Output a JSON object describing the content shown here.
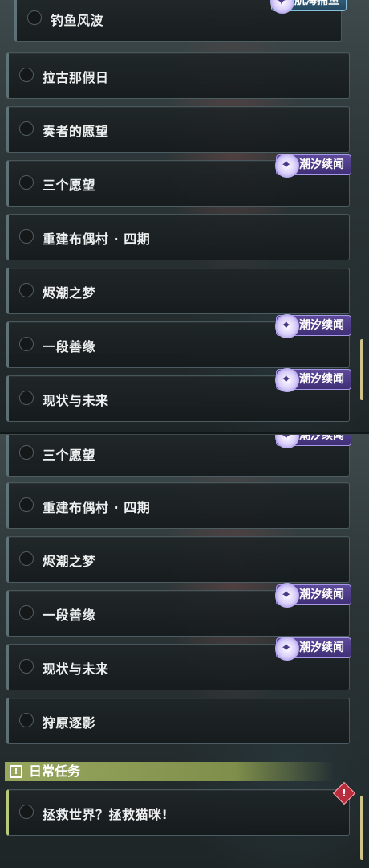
{
  "top_panel": {
    "items": [
      {
        "label": "钓鱼风波"
      },
      {
        "label": "拉古那假日"
      },
      {
        "label": "奏者的愿望"
      },
      {
        "label": "三个愿望"
      },
      {
        "label": "重建布偶村 · 四期"
      },
      {
        "label": "烬潮之梦"
      },
      {
        "label": "一段善缘"
      },
      {
        "label": "现状与未来"
      }
    ],
    "badges": {
      "voyage": "航海捕鱼",
      "tide_1": "潮汐续闻",
      "tide_2": "潮汐续闻",
      "tide_3": "潮汐续闻"
    }
  },
  "bottom_panel": {
    "items": [
      {
        "label": "三个愿望"
      },
      {
        "label": "重建布偶村 · 四期"
      },
      {
        "label": "烬潮之梦"
      },
      {
        "label": "一段善缘"
      },
      {
        "label": "现状与未来"
      },
      {
        "label": "狩原逐影"
      }
    ],
    "badges": {
      "tide_0": "潮汐续闻",
      "tide_1": "潮汐续闻",
      "tide_2": "潮汐续闻"
    },
    "section": {
      "title": "日常任务",
      "icon": "exclamation-icon"
    },
    "daily_item": {
      "label": "拯救世界？拯救猫咪!"
    }
  },
  "colors": {
    "badge_tide": "#4a3a86",
    "badge_voyage": "#2f5a78",
    "section_header": "#8f9f55",
    "alert": "#b82c3c",
    "scrollbar": "#cfc58a"
  }
}
